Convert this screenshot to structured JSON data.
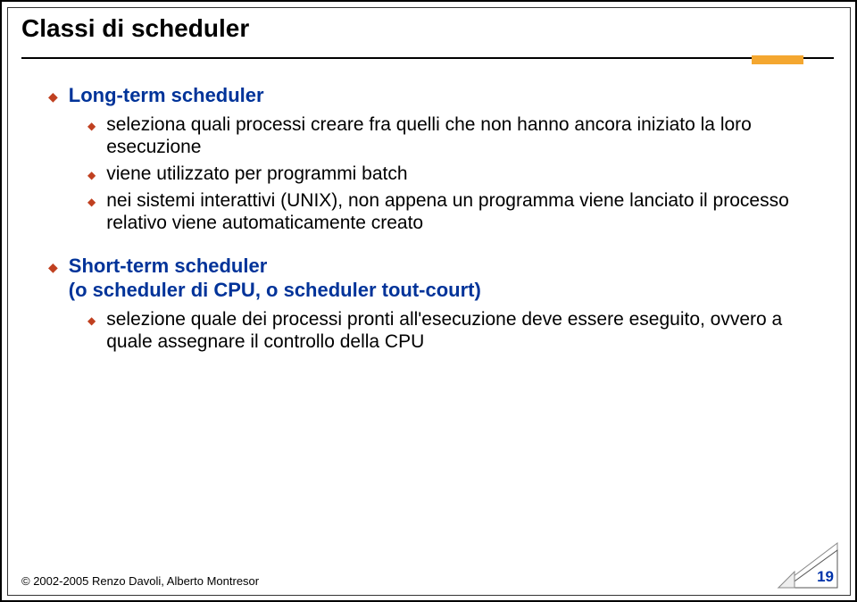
{
  "title": "Classi di scheduler",
  "sections": [
    {
      "heading": "Long-term scheduler",
      "items": [
        "seleziona quali processi creare fra quelli che non hanno ancora iniziato la loro esecuzione",
        "viene utilizzato per programmi batch",
        "nei sistemi interattivi (UNIX), non appena un programma viene lanciato il processo relativo viene automaticamente creato"
      ]
    },
    {
      "heading": "Short-term scheduler",
      "subheading": "(o scheduler di CPU, o scheduler tout-court)",
      "items": [
        "selezione quale dei processi pronti all'esecuzione deve essere eseguito, ovvero a quale assegnare il controllo della CPU"
      ]
    }
  ],
  "footer": "© 2002-2005 Renzo Davoli, Alberto Montresor",
  "page_number": "19"
}
